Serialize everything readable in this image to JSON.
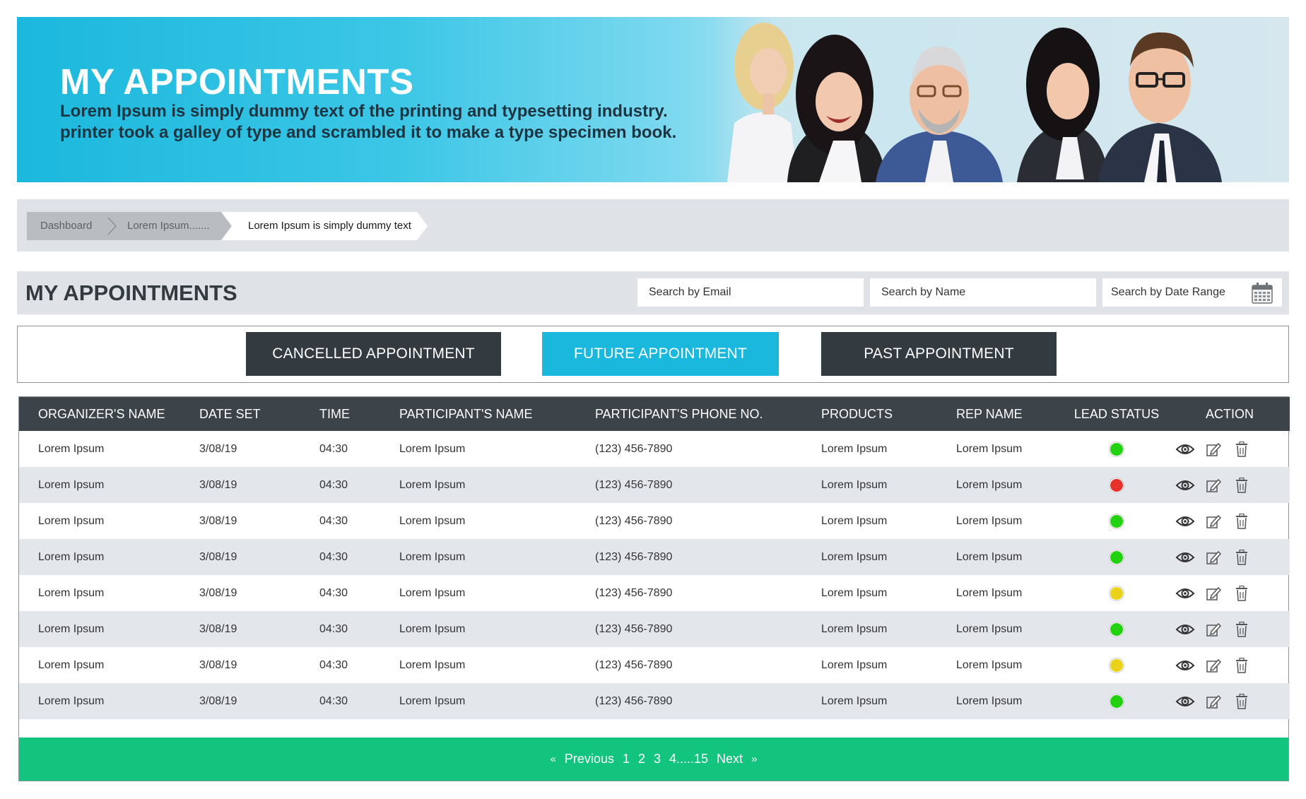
{
  "hero": {
    "title": "MY APPOINTMENTS",
    "subtitle_line1": "Lorem Ipsum is simply dummy text of the printing and typesetting industry.",
    "subtitle_line2": "printer took a galley of type and scrambled it to make a type specimen book."
  },
  "breadcrumb": {
    "items": [
      "Dashboard",
      "Lorem Ipsum.......",
      "Lorem Ipsum is simply dummy text"
    ]
  },
  "section": {
    "title": "MY APPOINTMENTS",
    "search_email_placeholder": "Search by Email",
    "search_name_placeholder": "Search by Name",
    "search_date_placeholder": "Search by Date Range",
    "calendar_icon": "calendar-icon"
  },
  "tabs": {
    "cancelled": "CANCELLED APPOINTMENT",
    "future": "FUTURE APPOINTMENT",
    "past": "PAST APPOINTMENT",
    "active": "future"
  },
  "table": {
    "columns": [
      "ORGANIZER'S NAME",
      "DATE SET",
      "TIME",
      "PARTICIPANT'S NAME",
      "PARTICIPANT'S PHONE NO.",
      "PRODUCTS",
      "REP NAME",
      "LEAD STATUS",
      "ACTION"
    ],
    "rows": [
      {
        "organizer": "Lorem Ipsum",
        "date": "3/08/19",
        "time": "04:30",
        "participant": "Lorem Ipsum",
        "phone": "(123) 456-7890",
        "products": "Lorem Ipsum",
        "rep": "Lorem Ipsum",
        "status": "green"
      },
      {
        "organizer": "Lorem Ipsum",
        "date": "3/08/19",
        "time": "04:30",
        "participant": "Lorem Ipsum",
        "phone": "(123) 456-7890",
        "products": "Lorem Ipsum",
        "rep": "Lorem Ipsum",
        "status": "red"
      },
      {
        "organizer": "Lorem Ipsum",
        "date": "3/08/19",
        "time": "04:30",
        "participant": "Lorem Ipsum",
        "phone": "(123) 456-7890",
        "products": "Lorem Ipsum",
        "rep": "Lorem Ipsum",
        "status": "green"
      },
      {
        "organizer": "Lorem Ipsum",
        "date": "3/08/19",
        "time": "04:30",
        "participant": "Lorem Ipsum",
        "phone": "(123) 456-7890",
        "products": "Lorem Ipsum",
        "rep": "Lorem Ipsum",
        "status": "green"
      },
      {
        "organizer": "Lorem Ipsum",
        "date": "3/08/19",
        "time": "04:30",
        "participant": "Lorem Ipsum",
        "phone": "(123) 456-7890",
        "products": "Lorem Ipsum",
        "rep": "Lorem Ipsum",
        "status": "yellow"
      },
      {
        "organizer": "Lorem Ipsum",
        "date": "3/08/19",
        "time": "04:30",
        "participant": "Lorem Ipsum",
        "phone": "(123) 456-7890",
        "products": "Lorem Ipsum",
        "rep": "Lorem Ipsum",
        "status": "green"
      },
      {
        "organizer": "Lorem Ipsum",
        "date": "3/08/19",
        "time": "04:30",
        "participant": "Lorem Ipsum",
        "phone": "(123) 456-7890",
        "products": "Lorem Ipsum",
        "rep": "Lorem Ipsum",
        "status": "yellow"
      },
      {
        "organizer": "Lorem Ipsum",
        "date": "3/08/19",
        "time": "04:30",
        "participant": "Lorem Ipsum",
        "phone": "(123) 456-7890",
        "products": "Lorem Ipsum",
        "rep": "Lorem Ipsum",
        "status": "green"
      }
    ],
    "actions": [
      "view-eye-icon",
      "edit-pencil-icon",
      "delete-trash-icon"
    ]
  },
  "pagination": {
    "prev_icon": "«",
    "previous": "Previous",
    "pages": [
      "1",
      "2",
      "3",
      "4.....15"
    ],
    "next": "Next",
    "next_icon": "»"
  },
  "colors": {
    "hero_accent": "#1ab8dd",
    "dark_button": "#333a40",
    "active_tab": "#1ab8dd",
    "table_header": "#3c4349",
    "row_alt": "#e3e6ea",
    "pager": "#12c47e",
    "status_green": "#22d10f",
    "status_red": "#e8312b",
    "status_yellow": "#ebd21a"
  }
}
